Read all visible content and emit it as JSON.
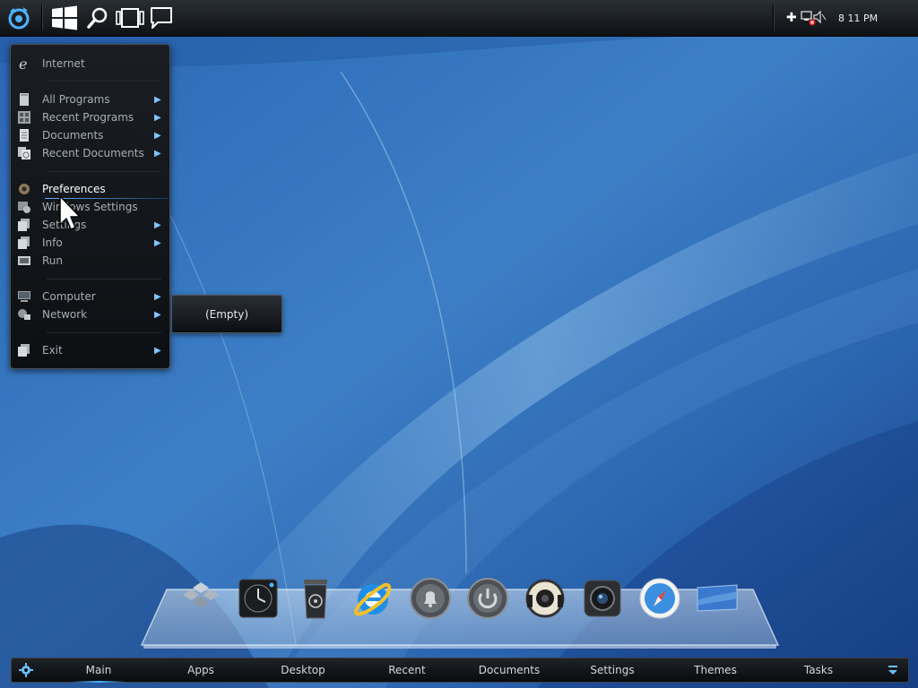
{
  "topbar": {
    "icons": [
      "app-logo-icon",
      "windows-icon",
      "search-icon",
      "task-view-icon",
      "chat-icon"
    ],
    "tray": {
      "icons": [
        "add-icon",
        "network-disconnected-icon",
        "volume-muted-icon"
      ],
      "time": "8 11 PM"
    }
  },
  "start_menu": {
    "items": [
      {
        "label": "Internet",
        "icon": "internet-explorer-icon",
        "has_submenu": false
      },
      {
        "label": "All Programs",
        "icon": "programs-icon",
        "has_submenu": true
      },
      {
        "label": "Recent Programs",
        "icon": "recent-programs-icon",
        "has_submenu": true
      },
      {
        "label": "Documents",
        "icon": "documents-icon",
        "has_submenu": true
      },
      {
        "label": "Recent Documents",
        "icon": "recent-documents-icon",
        "has_submenu": true
      },
      {
        "label": "Preferences",
        "icon": "preferences-icon",
        "has_submenu": false
      },
      {
        "label": "Windows Settings",
        "icon": "windows-settings-icon",
        "has_submenu": false
      },
      {
        "label": "Settings",
        "icon": "settings-icon",
        "has_submenu": true
      },
      {
        "label": "Info",
        "icon": "info-icon",
        "has_submenu": true
      },
      {
        "label": "Run",
        "icon": "run-icon",
        "has_submenu": false
      },
      {
        "label": "Computer",
        "icon": "computer-icon",
        "has_submenu": true
      },
      {
        "label": "Network",
        "icon": "network-icon",
        "has_submenu": true
      },
      {
        "label": "Exit",
        "icon": "exit-icon",
        "has_submenu": true
      }
    ],
    "hovered_item": "Preferences"
  },
  "submenu": {
    "label": "(Empty)"
  },
  "dock": {
    "icons": [
      "windows-tiles-icon",
      "clock-icon",
      "recycle-bin-icon",
      "internet-explorer-icon",
      "notification-bell-icon",
      "power-icon",
      "speaker-icon",
      "camera-icon",
      "safari-compass-icon",
      "desktop-icon"
    ]
  },
  "taskbar": {
    "tabs": [
      "Main",
      "Apps",
      "Desktop",
      "Recent",
      "Documents",
      "Settings",
      "Themes",
      "Tasks"
    ],
    "active_tab": "Main"
  },
  "colors": {
    "accent": "#4cb3ff",
    "desktop_blue": "#1d4f9a",
    "menu_bg": "#13171b"
  }
}
